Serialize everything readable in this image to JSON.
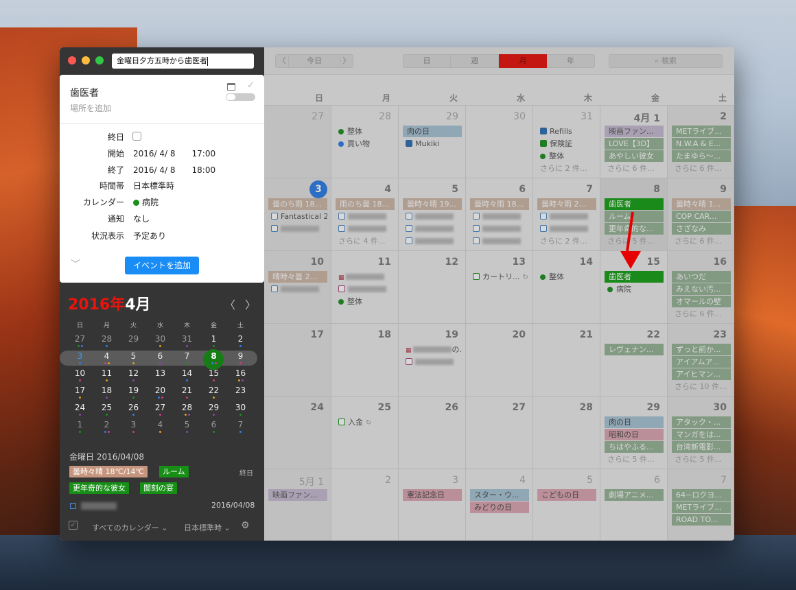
{
  "natural_language_input": "金曜日夕方五時から歯医者",
  "popover": {
    "title": "歯医者",
    "location_placeholder": "場所を追加",
    "rows": {
      "allday_label": "終日",
      "start_label": "開始",
      "start_value": "2016/ 4/ 8　　17:00",
      "end_label": "終了",
      "end_value": "2016/ 4/ 8　　18:00",
      "timezone_label": "時間帯",
      "timezone_value": "日本標準時",
      "calendar_label": "カレンダー",
      "calendar_value": "病院",
      "alert_label": "通知",
      "alert_value": "なし",
      "show_as_label": "状況表示",
      "show_as_value": "予定あり"
    },
    "add_button": "イベントを追加",
    "calendar_color": "#1b8f1b"
  },
  "mini_calendar": {
    "year": "2016年",
    "month": "4月",
    "weekdays": [
      "日",
      "月",
      "火",
      "水",
      "木",
      "金",
      "土"
    ],
    "weeks": [
      [
        "27",
        "28",
        "29",
        "30",
        "31",
        "1",
        "2"
      ],
      [
        "3",
        "4",
        "5",
        "6",
        "7",
        "8",
        "9"
      ],
      [
        "10",
        "11",
        "12",
        "13",
        "14",
        "15",
        "16"
      ],
      [
        "17",
        "18",
        "19",
        "20",
        "21",
        "22",
        "23"
      ],
      [
        "24",
        "25",
        "26",
        "27",
        "28",
        "29",
        "30"
      ],
      [
        "1",
        "2",
        "3",
        "4",
        "5",
        "6",
        "7"
      ]
    ],
    "selected": "8"
  },
  "day_detail": {
    "heading": "金曜日 2016/04/08",
    "chips": [
      "曇時々晴 18℃/14℃",
      "ルーム",
      "更年奇的な彼女",
      "闇刻の宴"
    ],
    "allday_label": "終日",
    "task_date": "2016/04/08"
  },
  "footer": {
    "calendars": "すべてのカレンダー ⌄",
    "timezone": "日本標準時 ⌄"
  },
  "toolbar": {
    "prev": "〈",
    "today": "今日",
    "next": "〉",
    "views": [
      "日",
      "週",
      "月",
      "年"
    ],
    "active_view": "月",
    "search_placeholder": "検索"
  },
  "month_view": {
    "weekdays": [
      "日",
      "月",
      "火",
      "水",
      "木",
      "金",
      "土"
    ],
    "weeks": [
      [
        {
          "day": "27",
          "dim": true,
          "events": []
        },
        {
          "day": "28",
          "dim": true,
          "events": [
            {
              "kind": "dot",
              "color": "#1f8f1f",
              "text": "整体"
            },
            {
              "kind": "dot",
              "color": "#2f7ee8",
              "text": "買い物"
            }
          ]
        },
        {
          "day": "29",
          "dim": true,
          "events": [
            {
              "kind": "bar",
              "style": "blue",
              "text": "肉の日"
            },
            {
              "kind": "box",
              "checked": true,
              "text": "Mukiki"
            }
          ]
        },
        {
          "day": "30",
          "dim": true,
          "events": []
        },
        {
          "day": "31",
          "dim": true,
          "events": [
            {
              "kind": "box",
              "checked": true,
              "text": "Refills"
            },
            {
              "kind": "boxg",
              "checked": true,
              "text": "保険証"
            },
            {
              "kind": "dot",
              "color": "#1f8f1f",
              "text": "整体"
            },
            {
              "kind": "more",
              "text": "さらに 2 件..."
            }
          ]
        },
        {
          "day": "4月 1",
          "dim": false,
          "events": [
            {
              "kind": "bar",
              "style": "purple",
              "text": "映画ファン..."
            },
            {
              "kind": "bar",
              "style": "green",
              "text": "LOVE【3D】"
            },
            {
              "kind": "bar",
              "style": "green",
              "text": "あやしい彼女"
            },
            {
              "kind": "more",
              "text": "さらに 6 件..."
            }
          ]
        },
        {
          "day": "2",
          "dim": false,
          "events": [
            {
              "kind": "bar",
              "style": "green",
              "text": "METライブ..."
            },
            {
              "kind": "bar",
              "style": "green",
              "text": "N.W.A & E..."
            },
            {
              "kind": "bar",
              "style": "green",
              "text": "たまゆら〜..."
            },
            {
              "kind": "more",
              "text": "さらに 6 件..."
            }
          ]
        }
      ],
      [
        {
          "day": "3",
          "today": true,
          "events": [
            {
              "kind": "bar",
              "style": "tan",
              "text": "曇のち雨 18..."
            },
            {
              "kind": "box",
              "checked": false,
              "text": "Fantastical 2"
            },
            {
              "kind": "boxblur",
              "text": ""
            }
          ]
        },
        {
          "day": "4",
          "events": [
            {
              "kind": "bar",
              "style": "tan",
              "text": "雨のち曇 18..."
            },
            {
              "kind": "boxblur",
              "text": ""
            },
            {
              "kind": "boxblur",
              "text": ""
            },
            {
              "kind": "more",
              "text": "さらに 4 件..."
            }
          ]
        },
        {
          "day": "5",
          "events": [
            {
              "kind": "bar",
              "style": "tan",
              "text": "曇時々晴 19..."
            },
            {
              "kind": "boxblur",
              "text": ""
            },
            {
              "kind": "boxblur",
              "text": ""
            },
            {
              "kind": "boxblur",
              "text": ""
            }
          ]
        },
        {
          "day": "6",
          "events": [
            {
              "kind": "bar",
              "style": "tan",
              "text": "曇時々雨 18..."
            },
            {
              "kind": "boxblur",
              "text": ""
            },
            {
              "kind": "boxblur",
              "text": ""
            },
            {
              "kind": "boxblur",
              "text": ""
            }
          ]
        },
        {
          "day": "7",
          "events": [
            {
              "kind": "bar",
              "style": "tan",
              "text": "曇時々雨 2..."
            },
            {
              "kind": "boxblur",
              "text": ""
            },
            {
              "kind": "boxblur",
              "text": ""
            },
            {
              "kind": "more",
              "text": "さらに 2 件..."
            }
          ]
        },
        {
          "day": "8",
          "fri8": true,
          "events": [
            {
              "kind": "bar",
              "style": "dental",
              "text": "歯医者"
            },
            {
              "kind": "bar",
              "style": "green",
              "text": "ルーム"
            },
            {
              "kind": "bar",
              "style": "green",
              "text": "更年奇的な..."
            },
            {
              "kind": "more",
              "text": "さらに 5 件..."
            }
          ]
        },
        {
          "day": "9",
          "events": [
            {
              "kind": "bar",
              "style": "tan",
              "text": "曇時々晴 1..."
            },
            {
              "kind": "bar",
              "style": "green",
              "text": "COP CAR..."
            },
            {
              "kind": "bar",
              "style": "green",
              "text": "さざなみ"
            },
            {
              "kind": "more",
              "text": "さらに 6 件..."
            }
          ]
        }
      ],
      [
        {
          "day": "10",
          "events": [
            {
              "kind": "bar",
              "style": "tan",
              "text": "晴時々曇 2..."
            },
            {
              "kind": "boxblur",
              "text": ""
            }
          ]
        },
        {
          "day": "11",
          "events": [
            {
              "kind": "blurred",
              "text": ""
            },
            {
              "kind": "boxpblur",
              "text": ""
            },
            {
              "kind": "dot",
              "color": "#1f8f1f",
              "text": "整体"
            }
          ]
        },
        {
          "day": "12",
          "events": []
        },
        {
          "day": "13",
          "events": [
            {
              "kind": "boxg",
              "checked": false,
              "text": "カートリ..."
            }
          ]
        },
        {
          "day": "14",
          "events": [
            {
              "kind": "dot",
              "color": "#1f8f1f",
              "text": "整体"
            }
          ]
        },
        {
          "day": "15",
          "events": [
            {
              "kind": "bar",
              "style": "dental",
              "text": "歯医者"
            },
            {
              "kind": "dot",
              "color": "#1f8f1f",
              "text": "病院"
            }
          ]
        },
        {
          "day": "16",
          "events": [
            {
              "kind": "bar",
              "style": "green",
              "text": "あいつだ"
            },
            {
              "kind": "bar",
              "style": "green",
              "text": "みえない汚..."
            },
            {
              "kind": "bar",
              "style": "green",
              "text": "オマールの壁"
            },
            {
              "kind": "more",
              "text": "さらに 6 件..."
            }
          ]
        }
      ],
      [
        {
          "day": "17",
          "events": []
        },
        {
          "day": "18",
          "events": []
        },
        {
          "day": "19",
          "events": [
            {
              "kind": "blurred",
              "text": "の..."
            },
            {
              "kind": "boxpblur",
              "text": ""
            }
          ]
        },
        {
          "day": "20",
          "events": []
        },
        {
          "day": "21",
          "events": []
        },
        {
          "day": "22",
          "events": [
            {
              "kind": "bar",
              "style": "green",
              "text": "レヴェナン..."
            }
          ]
        },
        {
          "day": "23",
          "events": [
            {
              "kind": "bar",
              "style": "green",
              "text": "ずっと前か..."
            },
            {
              "kind": "bar",
              "style": "green",
              "text": "アイアムア..."
            },
            {
              "kind": "bar",
              "style": "green",
              "text": "アイヒマン..."
            },
            {
              "kind": "more",
              "text": "さらに 10 件..."
            }
          ]
        }
      ],
      [
        {
          "day": "24",
          "events": []
        },
        {
          "day": "25",
          "events": [
            {
              "kind": "boxg",
              "checked": false,
              "text": "入金"
            }
          ]
        },
        {
          "day": "26",
          "events": []
        },
        {
          "day": "27",
          "events": []
        },
        {
          "day": "28",
          "events": []
        },
        {
          "day": "29",
          "events": [
            {
              "kind": "bar",
              "style": "blue",
              "text": "肉の日"
            },
            {
              "kind": "bar",
              "style": "pink",
              "text": "昭和の日"
            },
            {
              "kind": "bar",
              "style": "green",
              "text": "ちはやふる..."
            },
            {
              "kind": "more",
              "text": "さらに 5 件..."
            }
          ]
        },
        {
          "day": "30",
          "events": [
            {
              "kind": "bar",
              "style": "green",
              "text": "アタック・..."
            },
            {
              "kind": "bar",
              "style": "green",
              "text": "マンガをは..."
            },
            {
              "kind": "bar",
              "style": "green",
              "text": "台湾新電影..."
            },
            {
              "kind": "more",
              "text": "さらに 5 件..."
            }
          ]
        }
      ],
      [
        {
          "day": "5月 1",
          "dim": true,
          "events": [
            {
              "kind": "bar",
              "style": "purple",
              "text": "映画ファン..."
            }
          ]
        },
        {
          "day": "2",
          "dim": true,
          "events": []
        },
        {
          "day": "3",
          "dim": true,
          "events": [
            {
              "kind": "bar",
              "style": "pink",
              "text": "憲法記念日"
            }
          ]
        },
        {
          "day": "4",
          "dim": true,
          "events": [
            {
              "kind": "bar",
              "style": "blue",
              "text": "スター・ウ..."
            },
            {
              "kind": "bar",
              "style": "pink",
              "text": "みどりの日"
            }
          ]
        },
        {
          "day": "5",
          "dim": true,
          "events": [
            {
              "kind": "bar",
              "style": "pink",
              "text": "こどもの日"
            }
          ]
        },
        {
          "day": "6",
          "dim": true,
          "events": [
            {
              "kind": "bar",
              "style": "green",
              "text": "劇場アニメ..."
            }
          ]
        },
        {
          "day": "7",
          "dim": true,
          "events": [
            {
              "kind": "bar",
              "style": "green",
              "text": "64−ロクヨ..."
            },
            {
              "kind": "bar",
              "style": "green",
              "text": "METライブ..."
            },
            {
              "kind": "bar",
              "style": "green",
              "text": "ROAD TO..."
            }
          ]
        }
      ]
    ]
  }
}
